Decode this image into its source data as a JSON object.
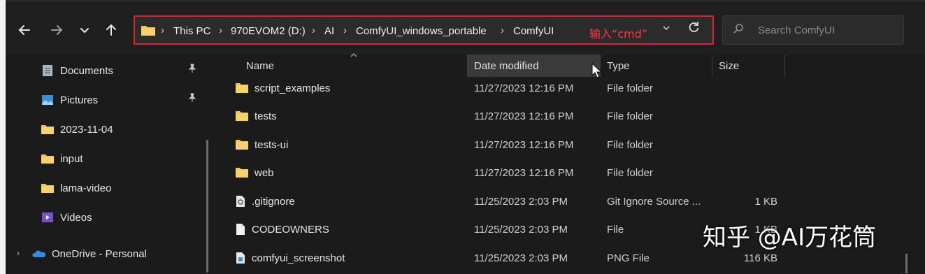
{
  "navigation": {
    "back_icon": "arrow-left",
    "forward_icon": "arrow-right",
    "recent_icon": "chevron-down",
    "up_icon": "arrow-up"
  },
  "address_bar": {
    "breadcrumbs": [
      "This PC",
      "970EVOM2 (D:)",
      "AI",
      "ComfyUI_windows_portable",
      "ComfyUI"
    ],
    "annotation": "输入“cmd”",
    "annotation_color": "#ff3b3b",
    "highlight_border_color": "#d9262a"
  },
  "search": {
    "placeholder": "Search ComfyUI"
  },
  "sidebar": {
    "items": [
      {
        "label": "Documents",
        "icon": "documents-icon",
        "pinned": true
      },
      {
        "label": "Pictures",
        "icon": "pictures-icon",
        "pinned": true
      },
      {
        "label": "2023-11-04",
        "icon": "folder-icon",
        "pinned": false
      },
      {
        "label": "input",
        "icon": "folder-icon",
        "pinned": false
      },
      {
        "label": "lama-video",
        "icon": "folder-icon",
        "pinned": false
      },
      {
        "label": "Videos",
        "icon": "videos-icon",
        "pinned": false
      },
      {
        "label": "OneDrive - Personal",
        "icon": "onedrive-icon",
        "pinned": false
      }
    ]
  },
  "file_list": {
    "columns": [
      "Name",
      "Date modified",
      "Type",
      "Size"
    ],
    "rows": [
      {
        "name": "script_examples",
        "date": "11/27/2023 12:16 PM",
        "type": "File folder",
        "size": "",
        "icon": "folder-icon"
      },
      {
        "name": "tests",
        "date": "11/27/2023 12:16 PM",
        "type": "File folder",
        "size": "",
        "icon": "folder-icon"
      },
      {
        "name": "tests-ui",
        "date": "11/27/2023 12:16 PM",
        "type": "File folder",
        "size": "",
        "icon": "folder-icon"
      },
      {
        "name": "web",
        "date": "11/27/2023 12:16 PM",
        "type": "File folder",
        "size": "",
        "icon": "folder-icon"
      },
      {
        "name": ".gitignore",
        "date": "11/25/2023 2:03 PM",
        "type": "Git Ignore Source ...",
        "size": "1 KB",
        "icon": "config-file-icon"
      },
      {
        "name": "CODEOWNERS",
        "date": "11/25/2023 2:03 PM",
        "type": "File",
        "size": "1 KB",
        "icon": "file-icon"
      },
      {
        "name": "comfyui_screenshot",
        "date": "11/25/2023 2:03 PM",
        "type": "PNG File",
        "size": "116 KB",
        "icon": "image-file-icon"
      }
    ]
  },
  "watermark": "知乎 @AI万花筒",
  "colors": {
    "background": "#1b1b1b",
    "folder": "#f4c44e",
    "highlight": "#d9262a"
  }
}
